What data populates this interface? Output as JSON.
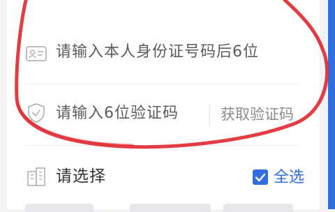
{
  "form": {
    "id_field": {
      "placeholder": "请输入本人身份证号码后6位",
      "icon": "id-card-icon"
    },
    "code_field": {
      "placeholder": "请输入6位验证码",
      "icon": "shield-icon",
      "get_code_label": "获取验证码"
    },
    "select_section": {
      "title": "请选择",
      "icon": "building-icon",
      "select_all_label": "全选",
      "select_all_checked": true
    }
  },
  "colors": {
    "accent": "#2f6de0",
    "annotation": "#e0282f",
    "placeholder_text": "#5c5c5c",
    "secondary_text": "#8c8c8c"
  }
}
